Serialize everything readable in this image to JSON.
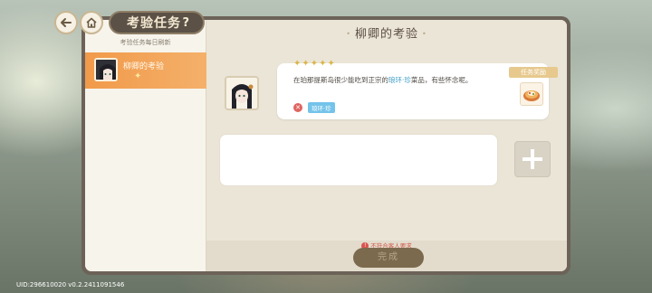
{
  "top_nav": {
    "back_icon": "arrow-left-icon",
    "home_icon": "home-icon",
    "title": "考验任务",
    "help_label": "?"
  },
  "sidebar": {
    "note": "考验任务每日刷新",
    "items": [
      {
        "label": "柳卿的考验",
        "star": "✦",
        "selected": true
      }
    ]
  },
  "main": {
    "header": "柳卿的考验",
    "dialogue": {
      "stars": "✦✦✦✦✦",
      "text_before": "在珀那提斯岛很少能吃到正宗的",
      "highlight": "琅环·珍",
      "text_after": "菜品，有些怀念呢。",
      "status_icon": "close-circle-icon",
      "tag": "琅环·珍"
    },
    "reward": {
      "label": "任务奖励",
      "icon": "dish-icon"
    },
    "add_icon": "plus-icon",
    "requirement": "不符合客人要求",
    "complete_label": "完成"
  },
  "footer": {
    "uid": "UID:296610020  v0.2.2411091546"
  },
  "colors": {
    "selected_item": "#f19a4a",
    "highlight": "#3f9ec7",
    "tag_bg": "#74c3ea",
    "warning": "#d05a4a",
    "complete_button": "#7c6a4e"
  }
}
